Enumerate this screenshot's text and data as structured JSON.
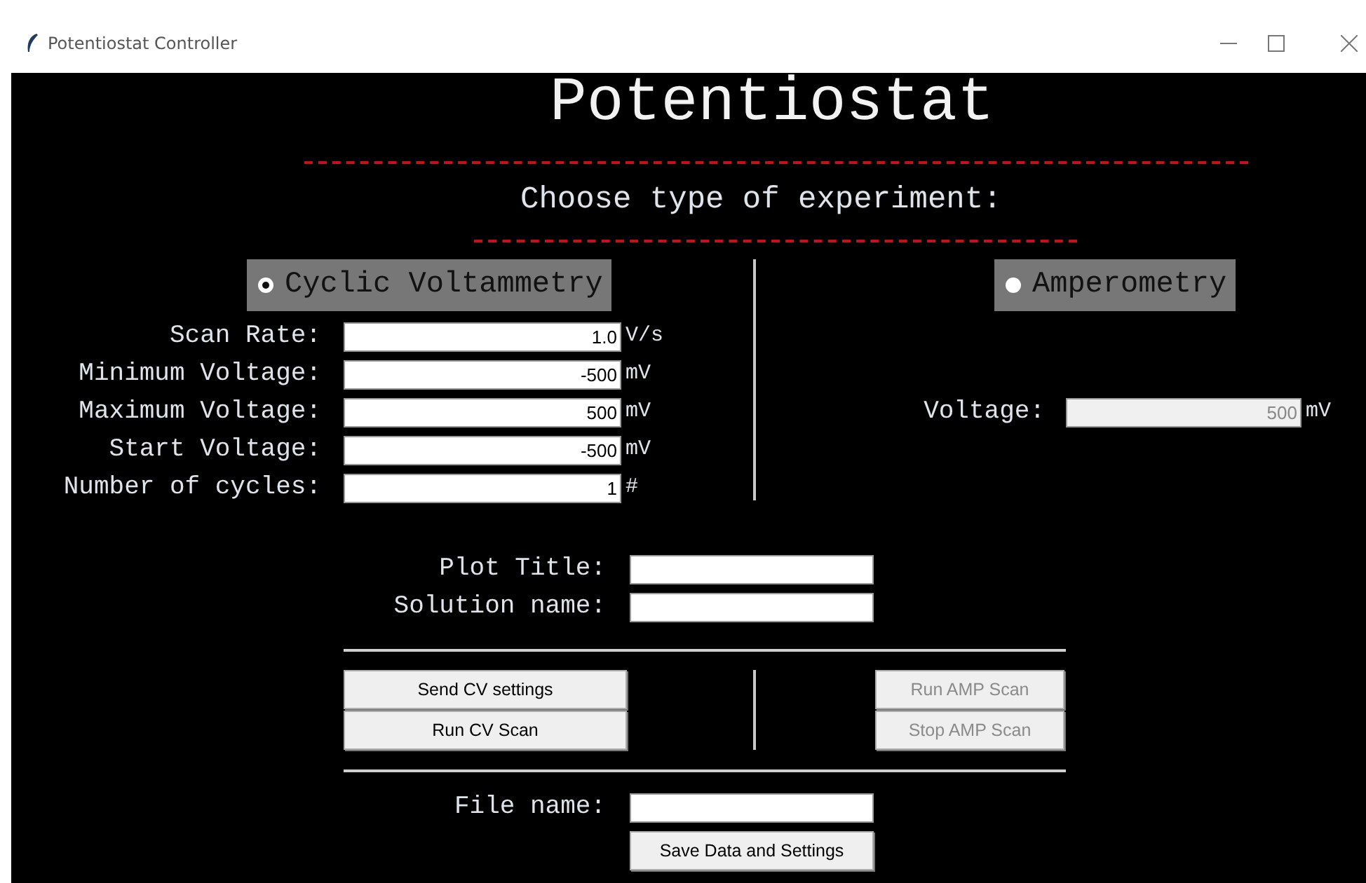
{
  "window": {
    "title": "Potentiostat Controller"
  },
  "heading": "Potentiostat",
  "subheading": "Choose type of experiment:",
  "modes": [
    {
      "label": "Cyclic Voltammetry",
      "selected": true
    },
    {
      "label": "Amperometry",
      "selected": false
    }
  ],
  "cv_fields": [
    {
      "label": "Scan Rate:",
      "value": "1.0",
      "unit": "V/s"
    },
    {
      "label": "Minimum Voltage:",
      "value": "-500",
      "unit": "mV"
    },
    {
      "label": "Maximum Voltage:",
      "value": "500",
      "unit": "mV"
    },
    {
      "label": "Start Voltage:",
      "value": "-500",
      "unit": "mV"
    },
    {
      "label": "Number of cycles:",
      "value": "1",
      "unit": "#"
    }
  ],
  "amp_fields": [
    {
      "label": "Voltage:",
      "value": "500",
      "unit": "mV",
      "disabled": true
    }
  ],
  "plot_fields": [
    {
      "label": "Plot Title:"
    },
    {
      "label": "Solution name:"
    }
  ],
  "cv_buttons": [
    {
      "label": "Send CV settings",
      "disabled": false
    },
    {
      "label": "Run CV Scan",
      "disabled": false
    }
  ],
  "amp_buttons": [
    {
      "label": "Run AMP Scan",
      "disabled": true
    },
    {
      "label": "Stop AMP Scan",
      "disabled": true
    }
  ],
  "file_field": {
    "label": "File name:"
  },
  "save_button": {
    "label": "Save Data and Settings"
  }
}
